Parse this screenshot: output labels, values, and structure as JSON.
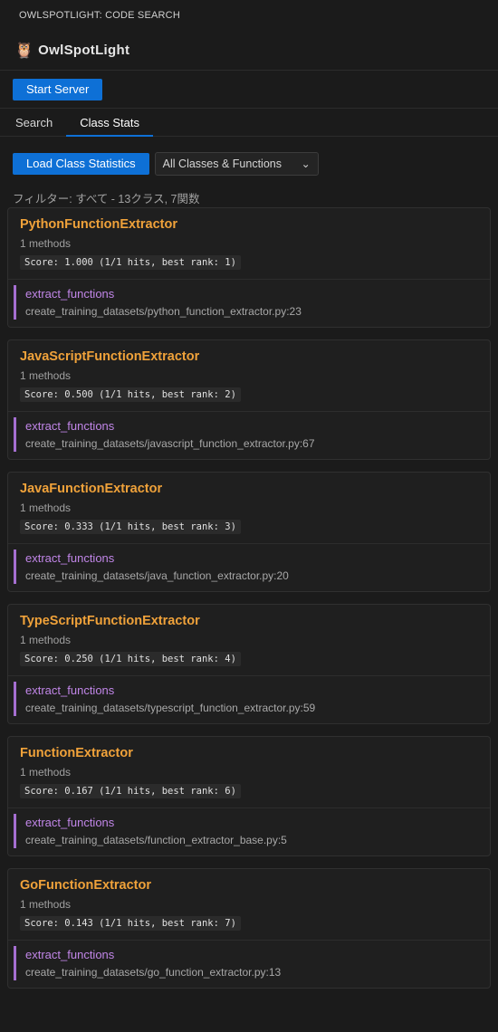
{
  "view_title": "OWLSPOTLIGHT: CODE SEARCH",
  "brand": {
    "icon": "owl-icon",
    "glyph": "🦉",
    "name": "OwlSpotLight"
  },
  "server_button": "Start Server",
  "tabs": [
    {
      "label": "Search",
      "active": false
    },
    {
      "label": "Class Stats",
      "active": true
    }
  ],
  "load_button": "Load Class Statistics",
  "filter_select": {
    "selected": "All Classes & Functions"
  },
  "filter_summary": "フィルター: すべて - 13クラス, 7関数",
  "accent_color": "#0e70d6",
  "classes": [
    {
      "name": "PythonFunctionExtractor",
      "methods_label": "1 methods",
      "score": "Score: 1.000 (1/1 hits, best rank: 1)",
      "method": "extract_functions",
      "path": "create_training_datasets/python_function_extractor.py:23"
    },
    {
      "name": "JavaScriptFunctionExtractor",
      "methods_label": "1 methods",
      "score": "Score: 0.500 (1/1 hits, best rank: 2)",
      "method": "extract_functions",
      "path": "create_training_datasets/javascript_function_extractor.py:67"
    },
    {
      "name": "JavaFunctionExtractor",
      "methods_label": "1 methods",
      "score": "Score: 0.333 (1/1 hits, best rank: 3)",
      "method": "extract_functions",
      "path": "create_training_datasets/java_function_extractor.py:20"
    },
    {
      "name": "TypeScriptFunctionExtractor",
      "methods_label": "1 methods",
      "score": "Score: 0.250 (1/1 hits, best rank: 4)",
      "method": "extract_functions",
      "path": "create_training_datasets/typescript_function_extractor.py:59"
    },
    {
      "name": "FunctionExtractor",
      "methods_label": "1 methods",
      "score": "Score: 0.167 (1/1 hits, best rank: 6)",
      "method": "extract_functions",
      "path": "create_training_datasets/function_extractor_base.py:5"
    },
    {
      "name": "GoFunctionExtractor",
      "methods_label": "1 methods",
      "score": "Score: 0.143 (1/1 hits, best rank: 7)",
      "method": "extract_functions",
      "path": "create_training_datasets/go_function_extractor.py:13"
    }
  ]
}
